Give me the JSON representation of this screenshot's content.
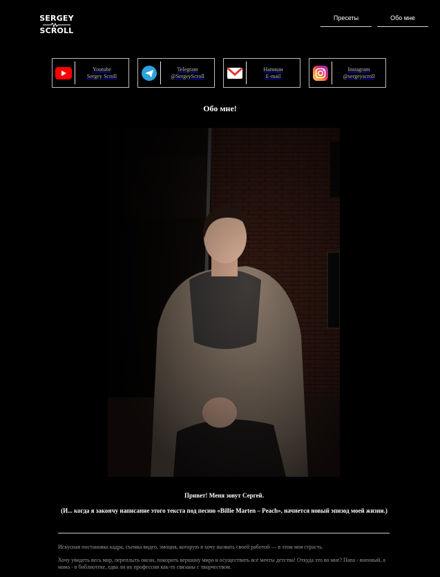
{
  "logo": {
    "line1": "SERGEY",
    "line2": "SCROLL"
  },
  "nav": {
    "presets": "Пресеты",
    "about": "Обо мне"
  },
  "socials": [
    {
      "icon": "youtube-icon",
      "title": "Youtube",
      "sub": "Sergey Scroll"
    },
    {
      "icon": "telegram-icon",
      "title": "Telegram",
      "sub": "@SergeyScroll"
    },
    {
      "icon": "mail-icon",
      "title": "Напиши",
      "sub": "E-mail"
    },
    {
      "icon": "instagram-icon",
      "title": "Instagram",
      "sub": "@sergeyscroll"
    }
  ],
  "page_title": "Обо мне!",
  "intro": "Привет! Меня зовут Сергей.",
  "quote": "(И... когда я закончу написание этого текста под песню «Billie Marten – Peach», начнется новый эпизод моей жизни.)",
  "para1": "Искусная постановка кадра, съемка видео, эмоция, которую я хочу вызвать своей работой — в этом моя страсть.",
  "para2": "Хочу увидеть весь мир, переплыть океан, покорить вершину мира и осуществить все мечты детства! Откуда это во мне? Папа - военный, а мама - в библиотеке, едва ли их профессии как-то связаны с творчеством.",
  "colors": {
    "background": "#000000",
    "youtube": "#ff0000",
    "telegram": "#2aa3df",
    "mail": "#e53935"
  }
}
